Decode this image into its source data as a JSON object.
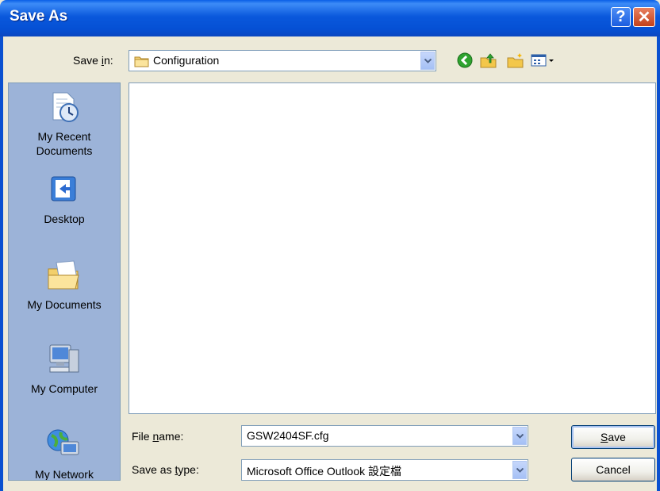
{
  "window": {
    "title": "Save As",
    "help_icon": "help-icon",
    "close_icon": "close-icon"
  },
  "toolbar": {
    "save_in_label_pre": "Save ",
    "save_in_label_u": "i",
    "save_in_label_post": "n:",
    "save_in_value": "Configuration",
    "icons": [
      "back-icon",
      "up-folder-icon",
      "new-folder-icon",
      "views-menu-icon"
    ]
  },
  "places": [
    {
      "label": "My Recent\nDocuments",
      "line1": "My Recent",
      "line2": "Documents",
      "icon": "recent-documents-icon"
    },
    {
      "label": "Desktop",
      "icon": "desktop-icon"
    },
    {
      "label": "My Documents",
      "icon": "my-documents-icon"
    },
    {
      "label": "My Computer",
      "icon": "my-computer-icon"
    },
    {
      "label": "My Network",
      "icon": "my-network-icon"
    }
  ],
  "file_name": {
    "label_pre": "File ",
    "label_u": "n",
    "label_post": "ame:",
    "value": "GSW2404SF.cfg"
  },
  "save_as_type": {
    "label_pre": "Save as ",
    "label_u": "t",
    "label_post": "ype:",
    "value": "Microsoft Office Outlook 設定檔"
  },
  "buttons": {
    "save_u": "S",
    "save_rest": "ave",
    "cancel": "Cancel"
  },
  "colors": {
    "title_bar": "#0a58dc",
    "dialog_bg": "#ece9d8",
    "places_bg": "#9cb3d8"
  }
}
